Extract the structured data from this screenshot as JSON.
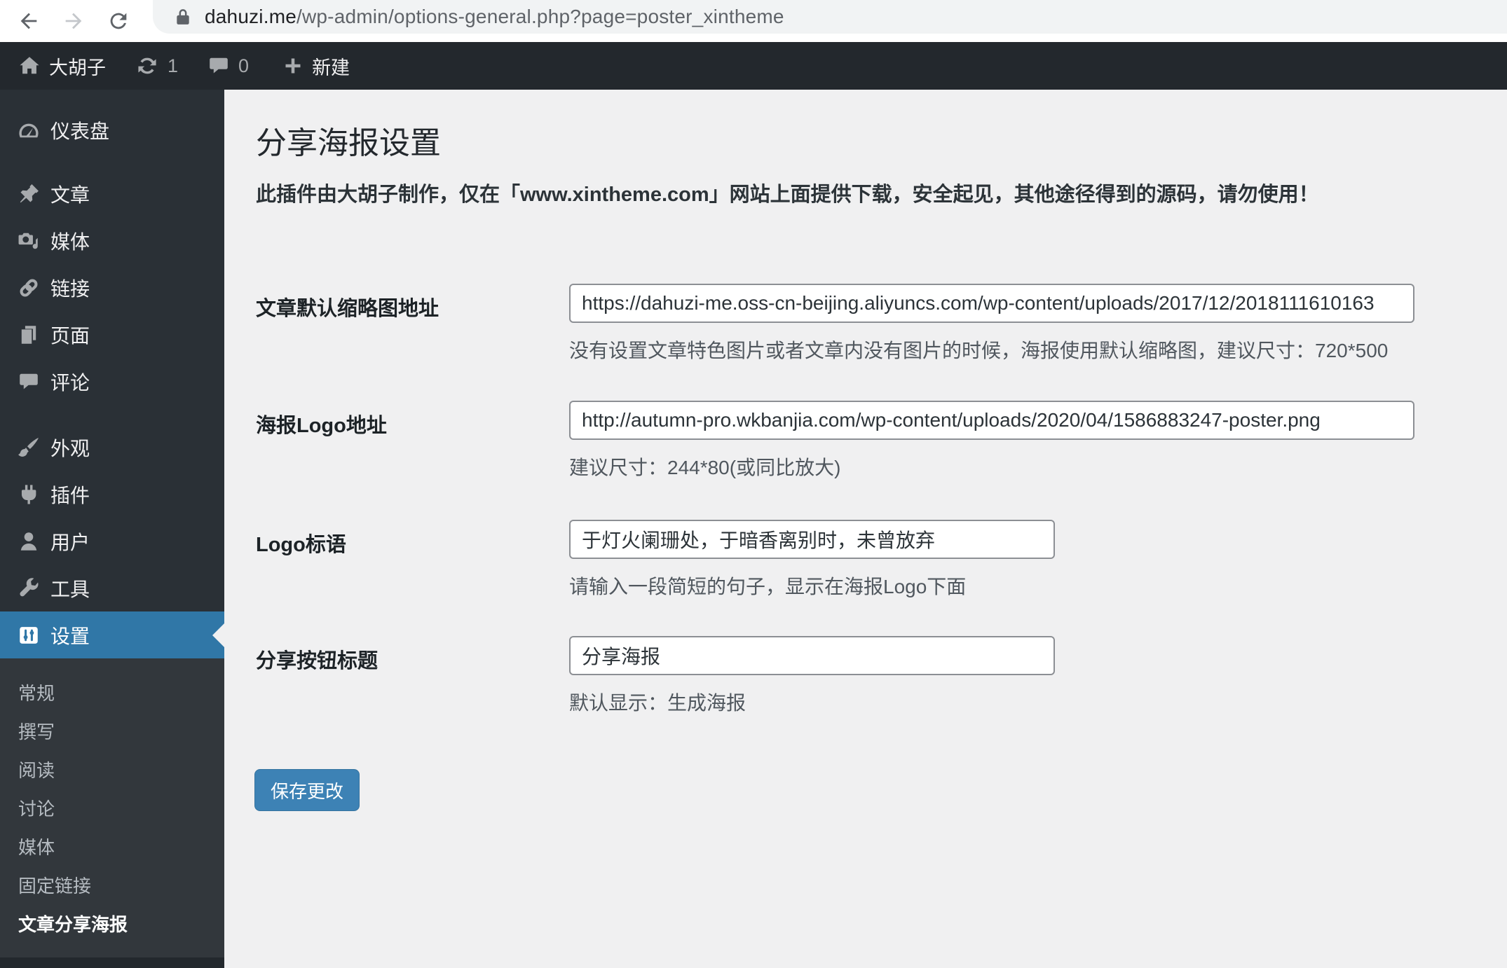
{
  "browser": {
    "url_domain": "dahuzi.me",
    "url_path": "/wp-admin/options-general.php?page=poster_xintheme"
  },
  "admin_bar": {
    "site_name": "大胡子",
    "update_count": "1",
    "comment_count": "0",
    "new_label": "新建"
  },
  "sidebar": {
    "items": [
      {
        "label": "仪表盘",
        "icon": "dashboard-icon"
      },
      {
        "label": "文章",
        "icon": "posts-icon"
      },
      {
        "label": "媒体",
        "icon": "media-icon"
      },
      {
        "label": "链接",
        "icon": "links-icon"
      },
      {
        "label": "页面",
        "icon": "pages-icon"
      },
      {
        "label": "评论",
        "icon": "comments-icon"
      },
      {
        "label": "外观",
        "icon": "appearance-icon"
      },
      {
        "label": "插件",
        "icon": "plugins-icon"
      },
      {
        "label": "用户",
        "icon": "users-icon"
      },
      {
        "label": "工具",
        "icon": "tools-icon"
      },
      {
        "label": "设置",
        "icon": "settings-icon",
        "current": true
      }
    ],
    "submenu": [
      {
        "label": "常规"
      },
      {
        "label": "撰写"
      },
      {
        "label": "阅读"
      },
      {
        "label": "讨论"
      },
      {
        "label": "媒体"
      },
      {
        "label": "固定链接"
      },
      {
        "label": "文章分享海报",
        "current": true
      }
    ]
  },
  "main": {
    "title": "分享海报设置",
    "description": "此插件由大胡子制作，仅在「www.xintheme.com」网站上面提供下载，安全起见，其他途径得到的源码，请勿使用！",
    "fields": [
      {
        "label": "文章默认缩略图地址",
        "value": "https://dahuzi-me.oss-cn-beijing.aliyuncs.com/wp-content/uploads/2017/12/2018111610163",
        "help": "没有设置文章特色图片或者文章内没有图片的时候，海报使用默认缩略图，建议尺寸：720*500"
      },
      {
        "label": "海报Logo地址",
        "value": "http://autumn-pro.wkbanjia.com/wp-content/uploads/2020/04/1586883247-poster.png",
        "help": "建议尺寸：244*80(或同比放大)"
      },
      {
        "label": "Logo标语",
        "value": "于灯火阑珊处，于暗香离别时，未曾放弃",
        "help": "请输入一段简短的句子，显示在海报Logo下面"
      },
      {
        "label": "分享按钮标题",
        "value": "分享海报",
        "help": "默认显示：生成海报"
      }
    ],
    "save_label": "保存更改"
  },
  "colors": {
    "accent_blue": "#3077a7",
    "button_blue": "#3d82b5",
    "admin_bar_bg": "#23282d",
    "sidebar_bg": "#2a3036",
    "submenu_bg": "#32373c",
    "content_bg": "#f0f0f1"
  }
}
